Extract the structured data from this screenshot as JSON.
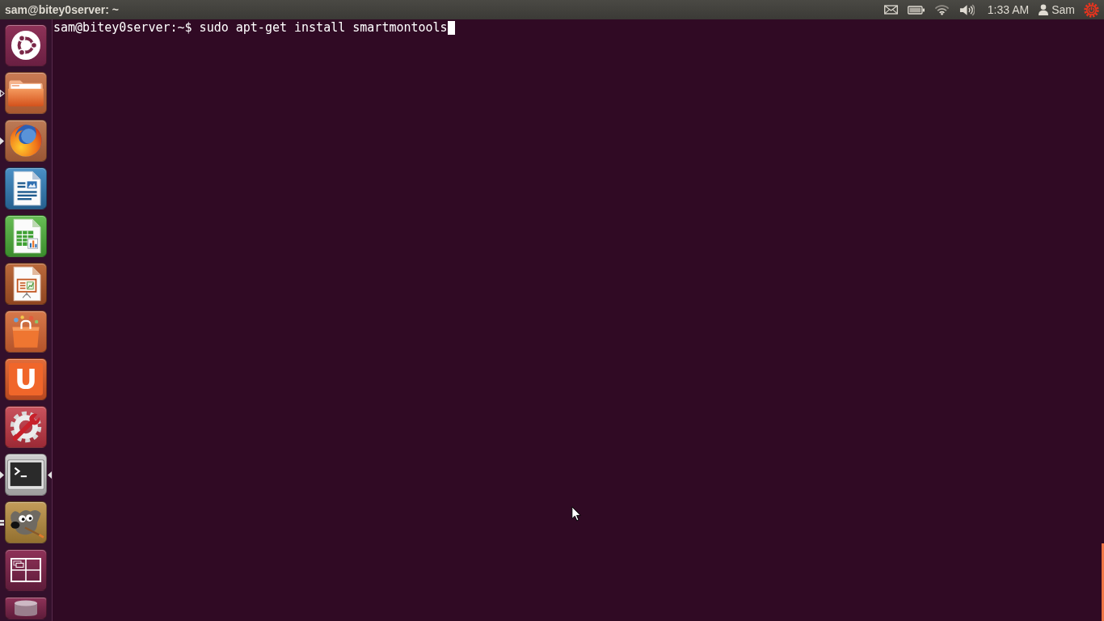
{
  "top_panel": {
    "window_title": "sam@bitey0server: ~",
    "indicators": [
      {
        "kind": "mail"
      },
      {
        "kind": "battery"
      },
      {
        "kind": "wifi"
      },
      {
        "kind": "sound"
      }
    ],
    "clock": "1:33 AM",
    "user": "Sam",
    "session": {
      "alert": true
    }
  },
  "launcher": {
    "items": [
      {
        "kind": "dash",
        "running": false,
        "other_workspace": false,
        "multiple_windows": false,
        "focused": false
      },
      {
        "kind": "files",
        "running": true,
        "other_workspace": true,
        "multiple_windows": false,
        "focused": false
      },
      {
        "kind": "browser",
        "running": true,
        "other_workspace": false,
        "multiple_windows": false,
        "focused": false
      },
      {
        "kind": "writer",
        "running": false,
        "other_workspace": false,
        "multiple_windows": false,
        "focused": false
      },
      {
        "kind": "calc",
        "running": false,
        "other_workspace": false,
        "multiple_windows": false,
        "focused": false
      },
      {
        "kind": "impress",
        "running": false,
        "other_workspace": false,
        "multiple_windows": false,
        "focused": false
      },
      {
        "kind": "software",
        "running": false,
        "other_workspace": false,
        "multiple_windows": false,
        "focused": false
      },
      {
        "kind": "cloud",
        "running": false,
        "other_workspace": false,
        "multiple_windows": false,
        "focused": false,
        "glyph": "U"
      },
      {
        "kind": "settings",
        "running": false,
        "other_workspace": false,
        "multiple_windows": false,
        "focused": false
      },
      {
        "kind": "terminal",
        "running": true,
        "other_workspace": false,
        "multiple_windows": false,
        "focused": true
      },
      {
        "kind": "paint",
        "running": true,
        "other_workspace": false,
        "multiple_windows": true,
        "focused": false
      },
      {
        "kind": "workspaces",
        "running": false,
        "other_workspace": false,
        "multiple_windows": false,
        "focused": false
      },
      {
        "kind": "trash",
        "running": false,
        "other_workspace": false,
        "multiple_windows": false,
        "focused": false
      }
    ]
  },
  "terminal": {
    "prompt": "sam@bitey0server:~$",
    "command": "sudo apt-get install smartmontools"
  }
}
